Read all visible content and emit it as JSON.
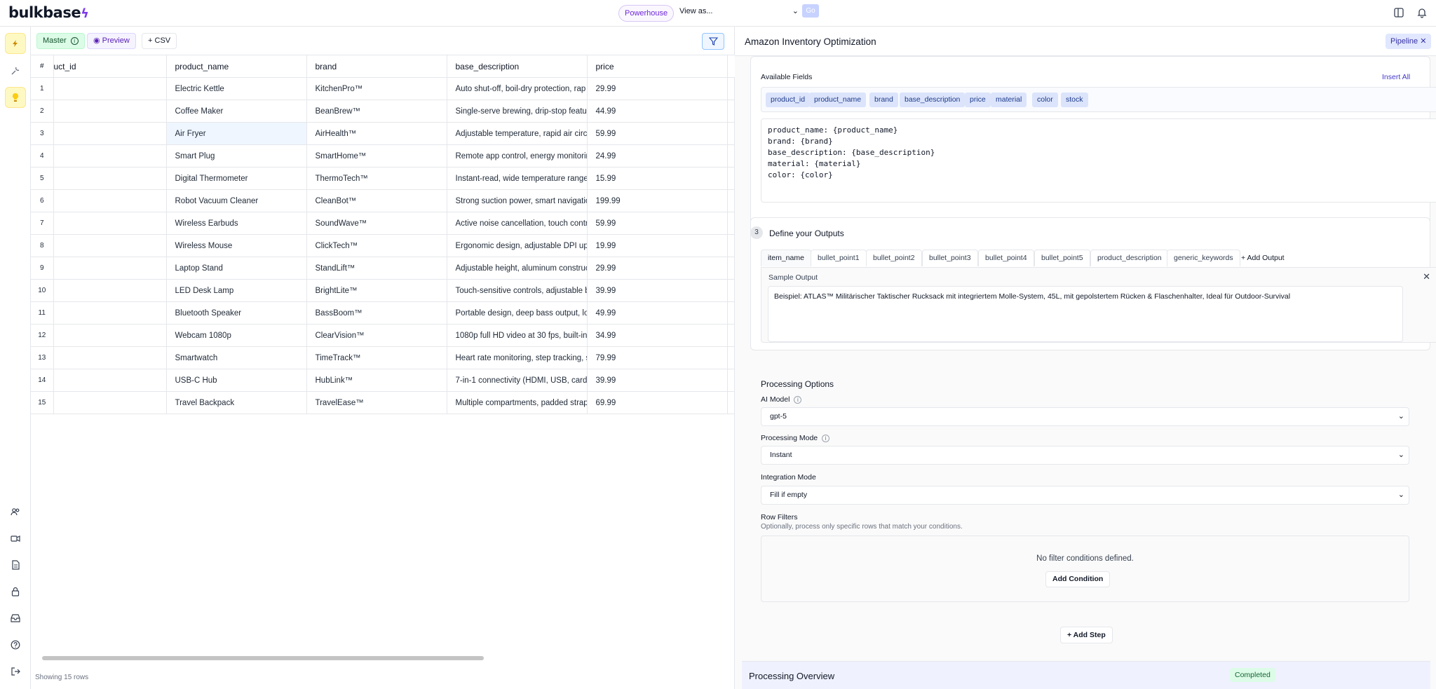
{
  "header": {
    "logo": "bulkbase",
    "workspace": "Powerhouse",
    "view_as": "View as...",
    "go_label": "Go"
  },
  "rail": {
    "top_icons": [
      "bolt-icon",
      "wrench-icon",
      "lightbulb-icon"
    ],
    "bottom_icons": [
      "users-icon",
      "video-icon",
      "document-icon",
      "lock-icon",
      "inbox-icon",
      "help-icon",
      "logout-icon"
    ]
  },
  "toolbar": {
    "master_label": "Master",
    "preview_label": "Preview",
    "csv_label": "CSV"
  },
  "table": {
    "columns": [
      "#",
      "uct_id",
      "product_name",
      "brand",
      "base_description",
      "price"
    ],
    "rows": [
      {
        "num": "1",
        "product_name": "Electric Kettle",
        "brand": "KitchenPro™",
        "base_description": "Auto shut-off, boil-dry protection, rap",
        "price": "29.99"
      },
      {
        "num": "2",
        "product_name": "Coffee Maker",
        "brand": "BeanBrew™",
        "base_description": "Single-serve brewing, drip-stop featur",
        "price": "44.99"
      },
      {
        "num": "3",
        "product_name": "Air Fryer",
        "brand": "AirHealth™",
        "base_description": "Adjustable temperature, rapid air circu",
        "price": "59.99"
      },
      {
        "num": "4",
        "product_name": "Smart Plug",
        "brand": "SmartHome™",
        "base_description": "Remote app control, energy monitorin",
        "price": "24.99"
      },
      {
        "num": "5",
        "product_name": "Digital Thermometer",
        "brand": "ThermoTech™",
        "base_description": "Instant-read, wide temperature range",
        "price": "15.99"
      },
      {
        "num": "6",
        "product_name": "Robot Vacuum Cleaner",
        "brand": "CleanBot™",
        "base_description": "Strong suction power, smart navigatio",
        "price": "199.99"
      },
      {
        "num": "7",
        "product_name": "Wireless Earbuds",
        "brand": "SoundWave™",
        "base_description": "Active noise cancellation, touch contr",
        "price": "59.99"
      },
      {
        "num": "8",
        "product_name": "Wireless Mouse",
        "brand": "ClickTech™",
        "base_description": "Ergonomic design, adjustable DPI up t",
        "price": "19.99"
      },
      {
        "num": "9",
        "product_name": "Laptop Stand",
        "brand": "StandLift™",
        "base_description": "Adjustable height, aluminum construc",
        "price": "29.99"
      },
      {
        "num": "10",
        "product_name": "LED Desk Lamp",
        "brand": "BrightLite™",
        "base_description": "Touch-sensitive controls, adjustable b",
        "price": "39.99"
      },
      {
        "num": "11",
        "product_name": "Bluetooth Speaker",
        "brand": "BassBoom™",
        "base_description": "Portable design, deep bass output, lo",
        "price": "49.99"
      },
      {
        "num": "12",
        "product_name": "Webcam 1080p",
        "brand": "ClearVision™",
        "base_description": "1080p full HD video at 30 fps, built-in",
        "price": "34.99"
      },
      {
        "num": "13",
        "product_name": "Smartwatch",
        "brand": "TimeTrack™",
        "base_description": "Heart rate monitoring, step tracking, s",
        "price": "79.99"
      },
      {
        "num": "14",
        "product_name": "USB-C Hub",
        "brand": "HubLink™",
        "base_description": "7-in-1 connectivity (HDMI, USB, card r",
        "price": "39.99"
      },
      {
        "num": "15",
        "product_name": "Travel Backpack",
        "brand": "TravelEase™",
        "base_description": "Multiple compartments, padded strap",
        "price": "69.99"
      }
    ],
    "row_count": "Showing 15 rows"
  },
  "panel": {
    "title": "Amazon Inventory Optimization",
    "pipeline_label": "Pipeline",
    "available_fields_title": "Available Fields",
    "insert_all": "Insert All",
    "fields": [
      "product_id",
      "product_name",
      "brand",
      "base_description",
      "price",
      "material",
      "color",
      "stock"
    ],
    "template_text": "product_name: {product_name}\nbrand: {brand}\nbase_description: {base_description}\nmaterial: {material}\ncolor: {color}",
    "step_number": "3",
    "step_title": "Define your Outputs",
    "output_tabs": [
      "item_name",
      "bullet_point1",
      "bullet_point2",
      "bullet_point3",
      "bullet_point4",
      "bullet_point5",
      "product_description",
      "generic_keywords"
    ],
    "add_output": "+ Add Output",
    "sample_output_label": "Sample Output",
    "sample_output_text": "Beispiel: ATLAS™ Militärischer Taktischer Rucksack mit integriertem Molle-System, 45L, mit gepolstertem Rücken & Flaschenhalter, Ideal für Outdoor-Survival",
    "processing_title": "Processing Options",
    "ai_model_label": "AI Model",
    "ai_model_value": "gpt-5",
    "processing_mode_label": "Processing Mode",
    "processing_mode_value": "Instant",
    "integration_mode_label": "Integration Mode",
    "integration_mode_value": "Fill if empty",
    "row_filters_label": "Row Filters",
    "row_filters_sub": "Optionally, process only specific rows that match your conditions.",
    "no_filters": "No filter conditions defined.",
    "add_condition": "Add Condition",
    "add_step": "Add Step",
    "overview_title": "Processing Overview",
    "overview_status": "Completed"
  },
  "colors": {
    "accent": "#7c3aed",
    "field_chip": "#dbe4fb",
    "completed": "#dcfce7"
  }
}
